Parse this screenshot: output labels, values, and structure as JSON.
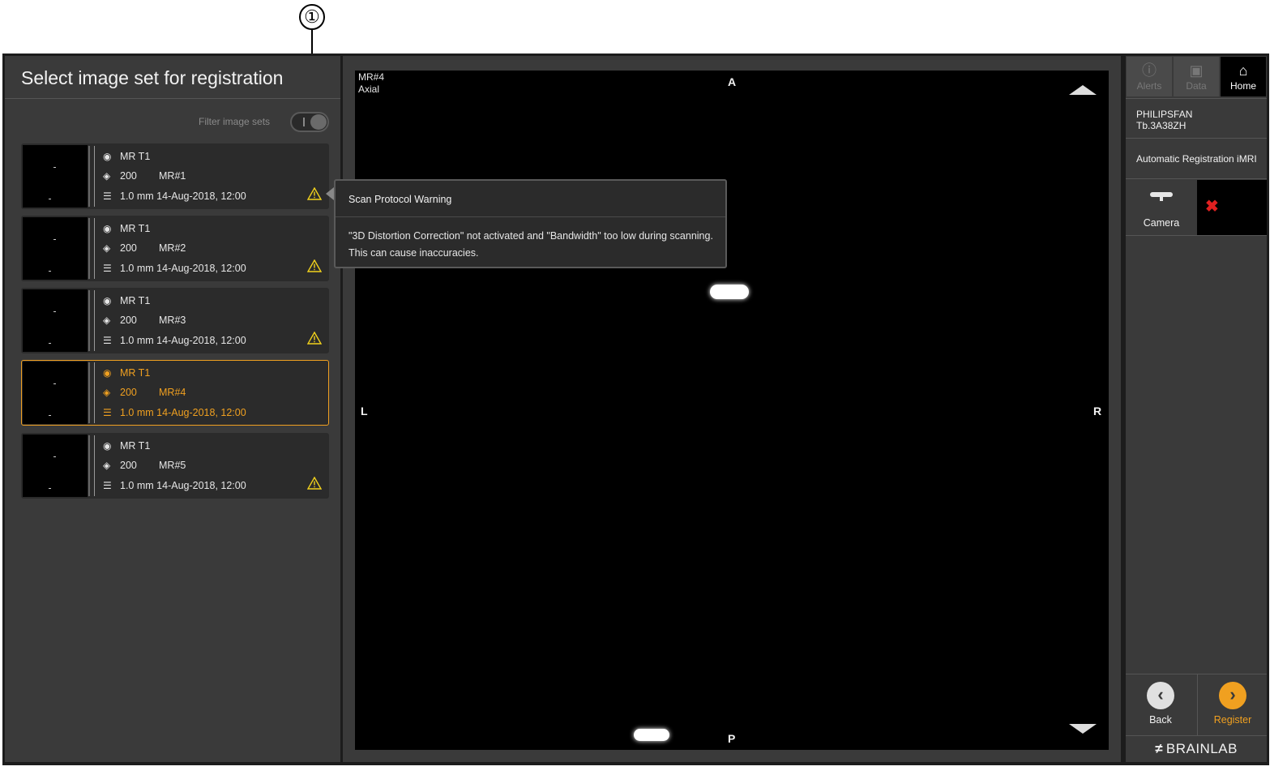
{
  "callout": {
    "number": "①"
  },
  "left_panel": {
    "title": "Select image set for registration",
    "filter_label": "Filter image sets",
    "filter_enabled": true
  },
  "image_sets": [
    {
      "modality": "MR T1",
      "slices": "200",
      "name": "MR#1",
      "thickness": "1.0 mm",
      "date": "14-Aug-2018, 12:00",
      "warning": true,
      "selected": false
    },
    {
      "modality": "MR T1",
      "slices": "200",
      "name": "MR#2",
      "thickness": "1.0 mm",
      "date": "14-Aug-2018, 12:00",
      "warning": true,
      "selected": false
    },
    {
      "modality": "MR T1",
      "slices": "200",
      "name": "MR#3",
      "thickness": "1.0 mm",
      "date": "14-Aug-2018, 12:00",
      "warning": true,
      "selected": false
    },
    {
      "modality": "MR T1",
      "slices": "200",
      "name": "MR#4",
      "thickness": "1.0 mm",
      "date": "14-Aug-2018, 12:00",
      "warning": false,
      "selected": true
    },
    {
      "modality": "MR T1",
      "slices": "200",
      "name": "MR#5",
      "thickness": "1.0 mm",
      "date": "14-Aug-2018, 12:00",
      "warning": true,
      "selected": false
    }
  ],
  "viewer": {
    "series": "MR#4",
    "view": "Axial",
    "orient_top": "A",
    "orient_bottom": "P",
    "orient_left": "L",
    "orient_right": "R"
  },
  "tooltip": {
    "title": "Scan Protocol Warning",
    "line1": "\"3D Distortion Correction\" not activated and \"Bandwidth\" too low during scanning.",
    "line2": "This can cause inaccuracies."
  },
  "right_panel": {
    "tabs": [
      {
        "label": "Alerts",
        "icon": "info-icon"
      },
      {
        "label": "Data",
        "icon": "patient-data-icon"
      },
      {
        "label": "Home",
        "icon": "home-icon"
      }
    ],
    "patient_line1": "PHILIPSFAN",
    "patient_line2": "Tb.3A38ZH",
    "workflow": "Automatic Registration iMRI",
    "camera_label": "Camera",
    "camera_status_icon": "red-x-icon",
    "back_label": "Back",
    "register_label": "Register",
    "brand": "BRAINLAB"
  },
  "colors": {
    "accent": "#f0a020",
    "warning": "#f2d21c",
    "error": "#e02020",
    "panel": "#3a3a3a",
    "card": "#2b2b2b"
  }
}
